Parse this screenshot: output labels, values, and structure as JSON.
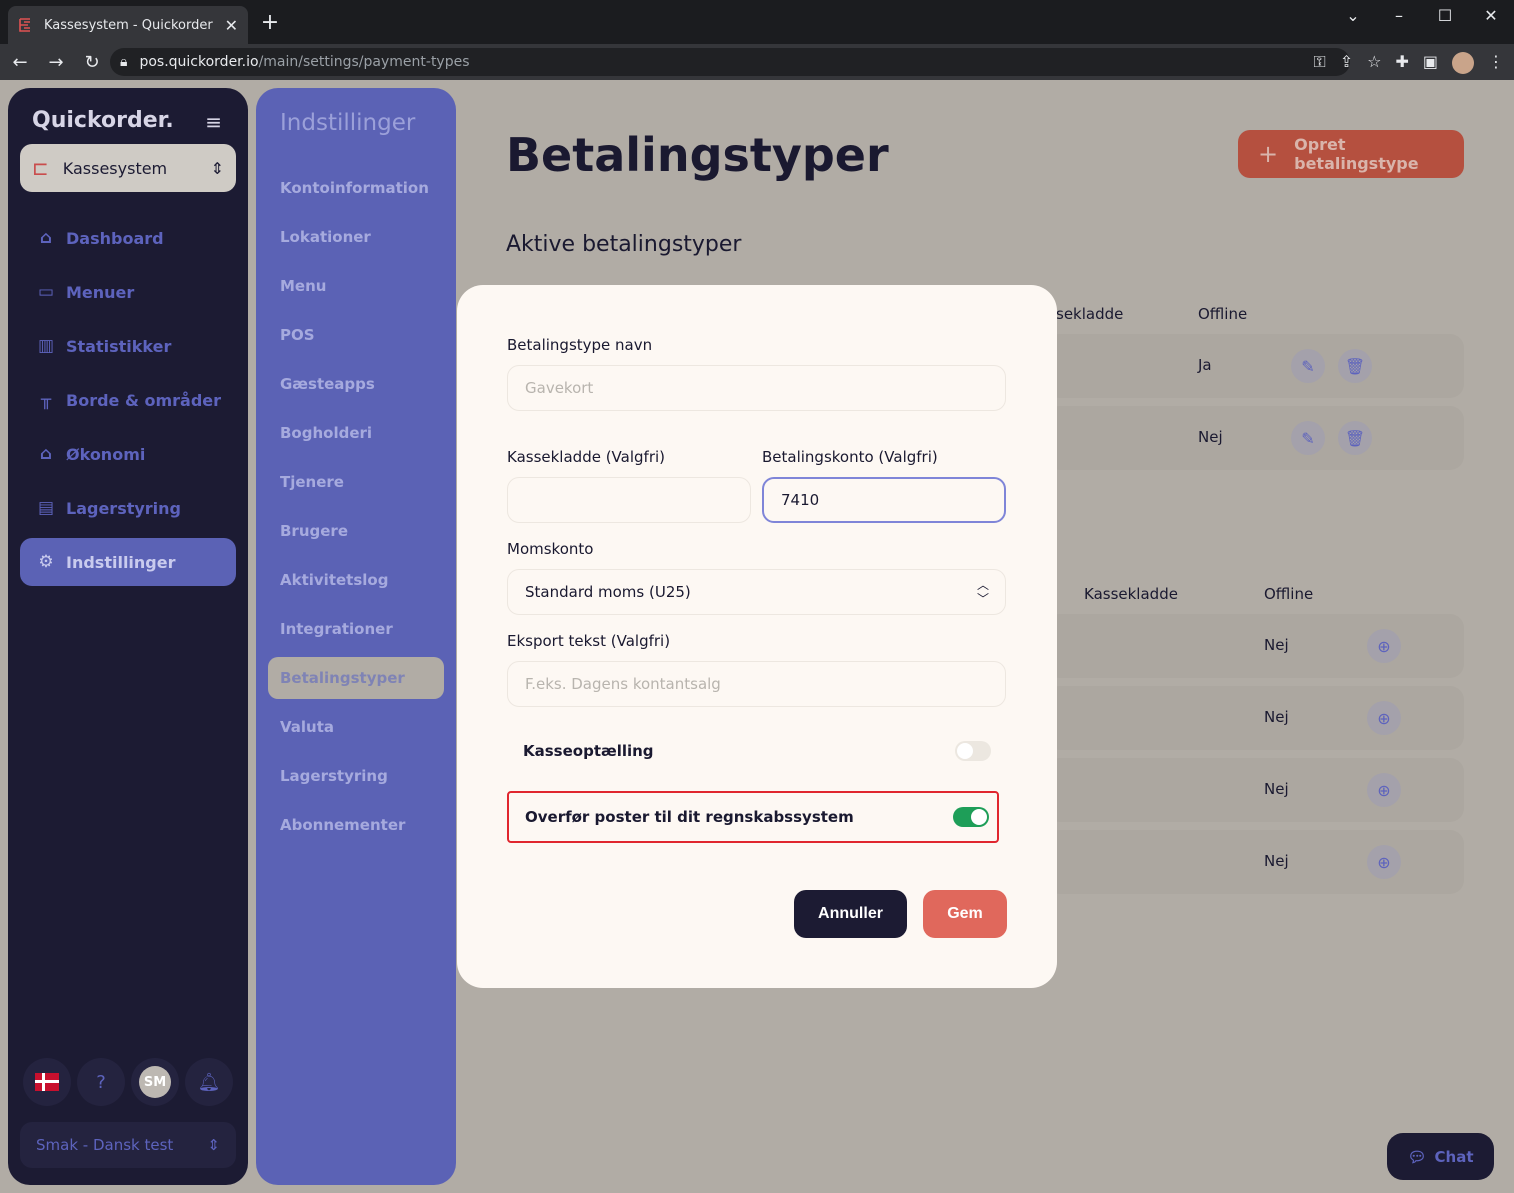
{
  "browser": {
    "tab_title": "Kassesystem - Quickorder",
    "url_host": "pos.quickorder.io",
    "url_path": "/main/settings/payment-types"
  },
  "sidebar": {
    "brand": "Quickorder.",
    "switcher": "Kassesystem",
    "items": [
      {
        "label": "Dashboard",
        "icon": "home-icon"
      },
      {
        "label": "Menuer",
        "icon": "book-icon"
      },
      {
        "label": "Statistikker",
        "icon": "chart-icon"
      },
      {
        "label": "Borde & områder",
        "icon": "table-icon"
      },
      {
        "label": "Økonomi",
        "icon": "bank-icon"
      },
      {
        "label": "Lagerstyring",
        "icon": "archive-icon"
      },
      {
        "label": "Indstillinger",
        "icon": "gear-icon"
      }
    ],
    "user_initials": "SM",
    "org": "Smak - Dansk test"
  },
  "settings_nav": {
    "title": "Indstillinger",
    "items": [
      "Kontoinformation",
      "Lokationer",
      "Menu",
      "POS",
      "Gæsteapps",
      "Bogholderi",
      "Tjenere",
      "Brugere",
      "Aktivitetslog",
      "Integrationer",
      "Betalingstyper",
      "Valuta",
      "Lagerstyring",
      "Abonnementer"
    ],
    "active_index": 10
  },
  "main": {
    "title": "Betalingstyper",
    "create_button": "Opret betalingstype",
    "active_section": "Aktive betalingstyper",
    "active_table": {
      "col_cash": "sekladde",
      "col_offline": "Offline",
      "rows": [
        {
          "offline": "Ja"
        },
        {
          "offline": "Nej"
        }
      ]
    },
    "inactive_table": {
      "col_cash": "Kassekladde",
      "col_offline": "Offline",
      "rows": [
        {
          "offline": "Nej"
        },
        {
          "offline": "Nej"
        },
        {
          "offline": "Nej"
        },
        {
          "offline": "Nej"
        }
      ]
    }
  },
  "modal": {
    "name_label": "Betalingstype navn",
    "name_placeholder": "Gavekort",
    "cash_label": "Kassekladde (Valgfri)",
    "cash_value": "",
    "account_label": "Betalingskonto (Valgfri)",
    "account_value": "7410",
    "vat_label": "Momskonto",
    "vat_value": "Standard moms (U25)",
    "export_label": "Eksport tekst (Valgfri)",
    "export_placeholder": "F.eks. Dagens kontantsalg",
    "count_label": "Kasseoptælling",
    "count_on": false,
    "transfer_label": "Overfør poster til dit regnskabssystem",
    "transfer_on": true,
    "cancel": "Annuller",
    "save": "Gem"
  },
  "chat": "Chat"
}
